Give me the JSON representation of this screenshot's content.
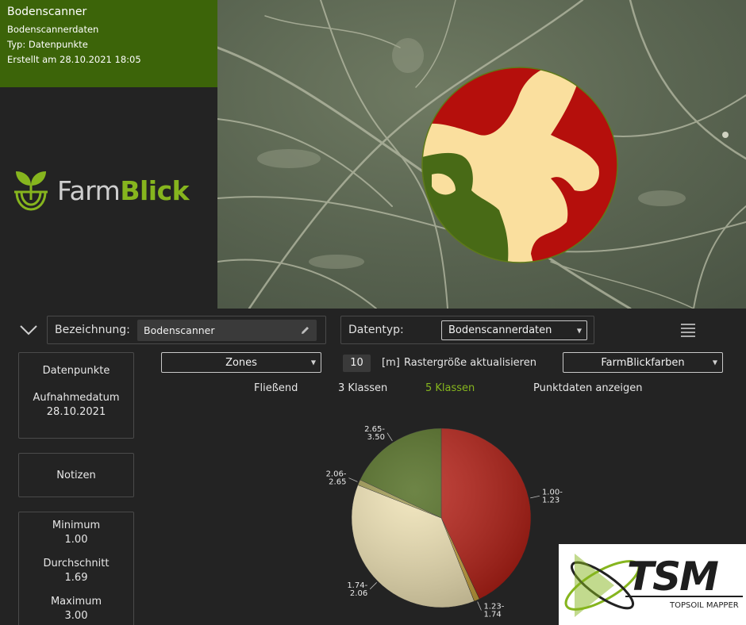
{
  "info": {
    "title": "Bodenscanner",
    "subtitle": "Bodenscannerdaten",
    "type_line": "Typ: Datenpunkte",
    "created_line": "Erstellt am 28.10.2021 18:05"
  },
  "logo": {
    "farm": "Farm",
    "blick": "Blick"
  },
  "toolbar": {
    "name_label": "Bezeichnung:",
    "name_value": "Bodenscanner",
    "type_label": "Datentyp:",
    "type_value": "Bodenscannerdaten"
  },
  "cards": {
    "points_label": "Datenpunkte",
    "date_label": "Aufnahmedatum",
    "date_value": "28.10.2021",
    "notes_label": "Notizen",
    "min_label": "Minimum",
    "min_value": "1.00",
    "avg_label": "Durchschnitt",
    "avg_value": "1.69",
    "max_label": "Maximum",
    "max_value": "3.00"
  },
  "controls": {
    "zones_select": "Zones",
    "raster_value": "10",
    "raster_unit": "[m]",
    "raster_update": "Rastergröße aktualisieren",
    "color_select": "FarmBlickfarben",
    "opt_flowing": "Fließend",
    "opt_3": "3 Klassen",
    "opt_5": "5 Klassen",
    "opt_points": "Punktdaten anzeigen"
  },
  "colors": {
    "accent_green": "#86b51e",
    "header_green": "#3c6409",
    "zone_red": "#b50f0c",
    "zone_cream": "#fadf9e",
    "zone_darkgreen": "#486a16"
  },
  "chart_data": {
    "type": "pie",
    "categories": [
      "1.00-1.23",
      "1.23-1.74",
      "1.74-2.06",
      "2.06-2.65",
      "2.65-3.50"
    ],
    "values": [
      43,
      1,
      37,
      1,
      18
    ],
    "colors": [
      "#b61e14",
      "#c9a23a",
      "#f0e3b4",
      "#a09a50",
      "#4e6a1e"
    ],
    "labels": [
      [
        "1.00-",
        "1.23"
      ],
      [
        "1.23-",
        "1.74"
      ],
      [
        "1.74-",
        "2.06"
      ],
      [
        "2.06-",
        "2.65"
      ],
      [
        "2.65-",
        "3.50"
      ]
    ],
    "title": ""
  },
  "tsm": {
    "main": "TSM",
    "sub": "TOPSOIL MAPPER"
  }
}
